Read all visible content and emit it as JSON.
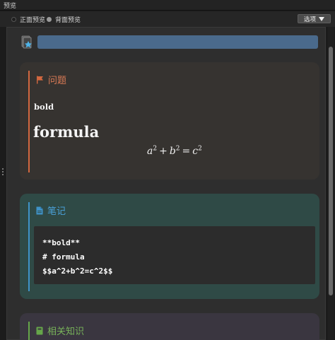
{
  "window": {
    "title": "预览"
  },
  "toolbar": {
    "front_label": "正面预览",
    "back_label": "背面预览",
    "selected": "back",
    "options_label": "选项"
  },
  "deck": {
    "name": "",
    "bar_color": "#4a6a8c"
  },
  "cards": {
    "question": {
      "title": "问题",
      "icon": "flag-icon",
      "bold_text": "bold",
      "heading_text": "formula",
      "math": {
        "a": "a",
        "b": "b",
        "c": "c",
        "exp": "2",
        "plus": "+",
        "eq": "="
      },
      "accent_color": "#d4683f"
    },
    "note": {
      "title": "笔记",
      "icon": "document-icon",
      "code_lines": [
        "**bold**",
        "# formula",
        "$$a^2+b^2=c^2$$"
      ],
      "accent_color": "#3f93c8"
    },
    "related": {
      "title": "相关知识",
      "icon": "book-icon",
      "accent_color": "#66a64a"
    }
  }
}
